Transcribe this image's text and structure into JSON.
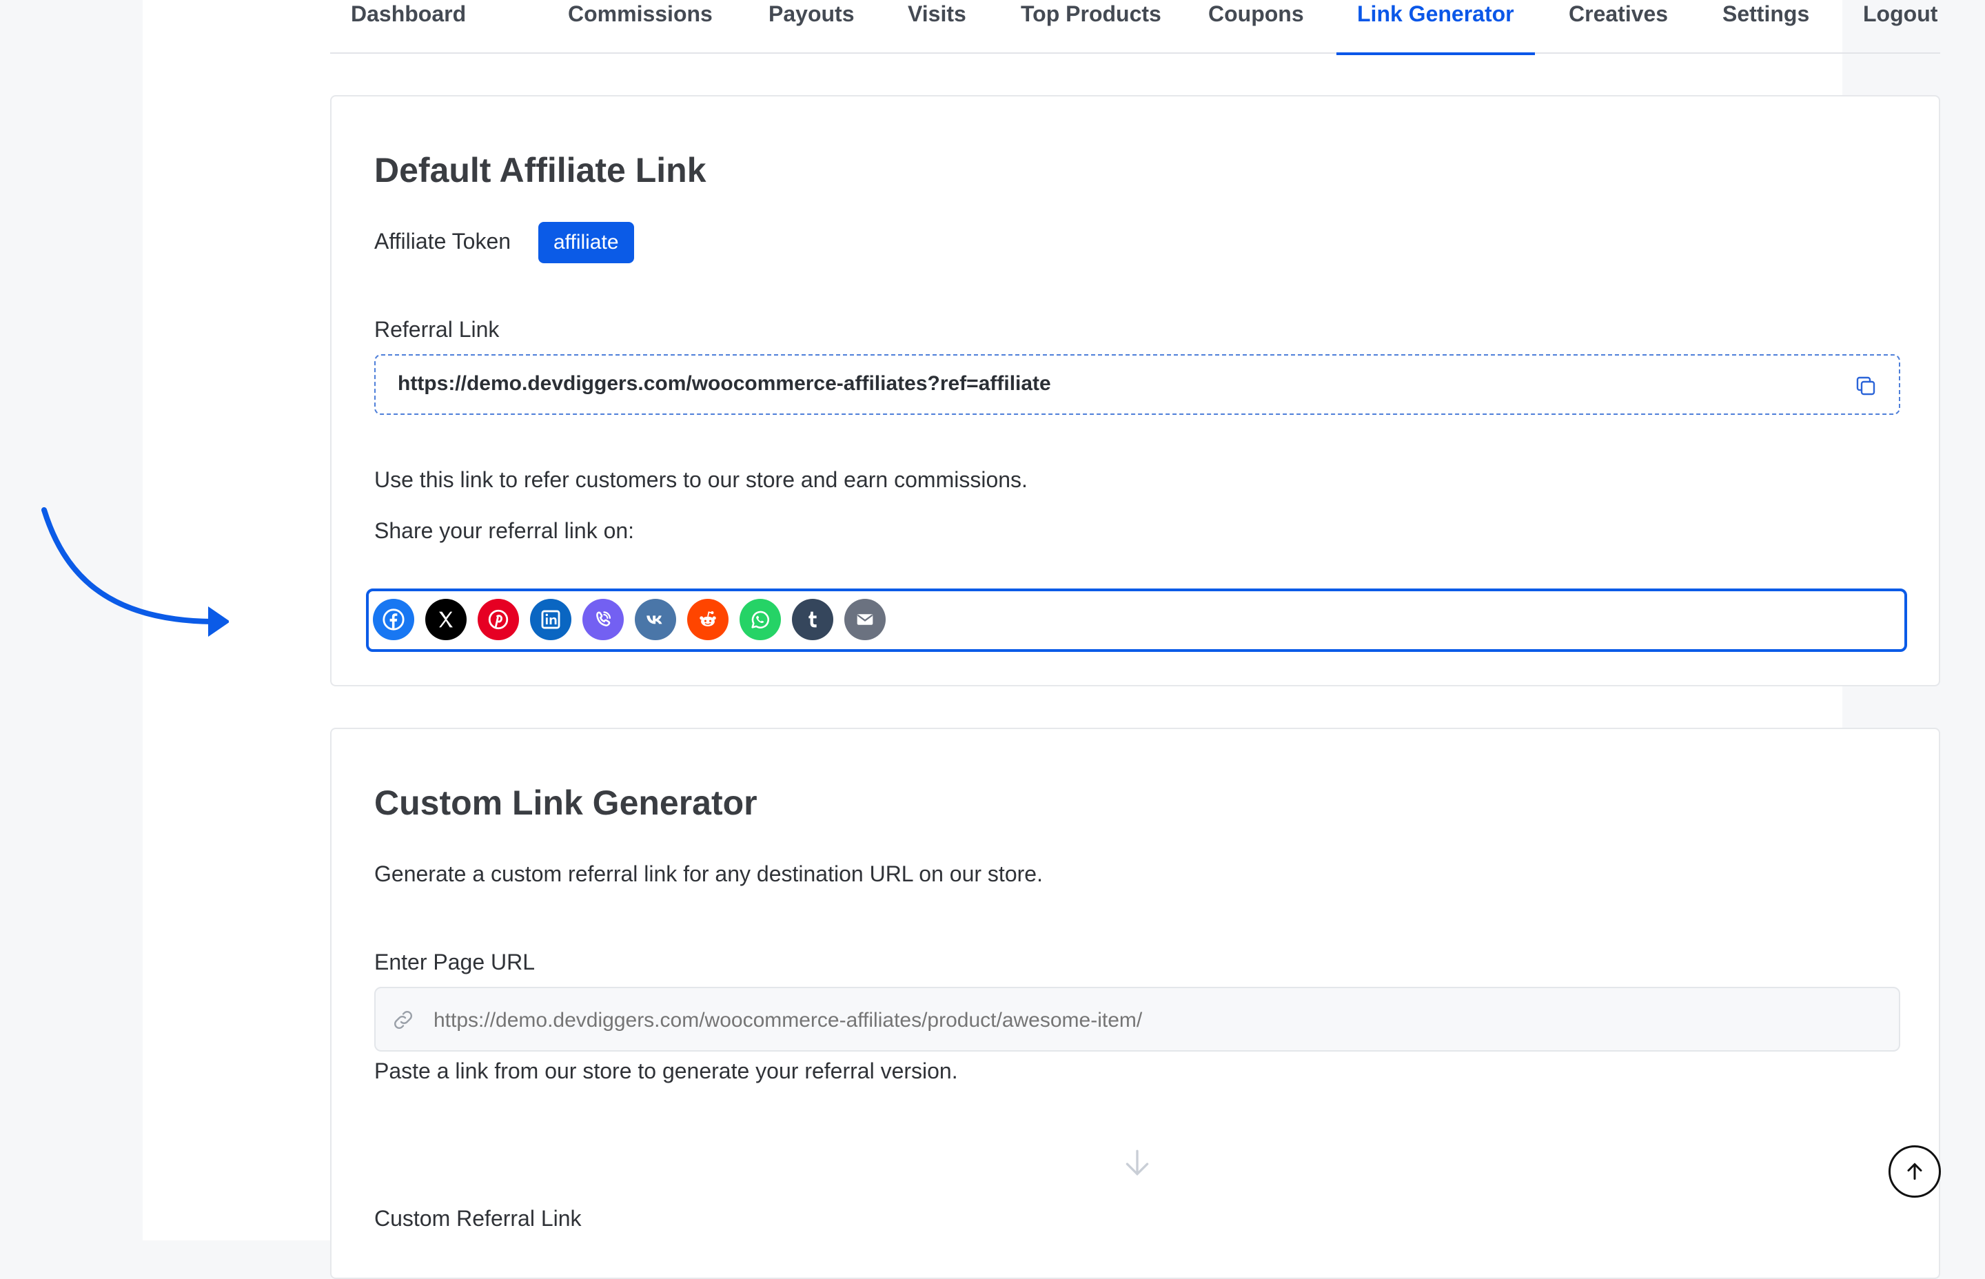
{
  "tabs": [
    {
      "label": "Dashboard",
      "active": false
    },
    {
      "label": "Commissions",
      "active": false
    },
    {
      "label": "Payouts",
      "active": false
    },
    {
      "label": "Visits",
      "active": false
    },
    {
      "label": "Top Products",
      "active": false
    },
    {
      "label": "Coupons",
      "active": false
    },
    {
      "label": "Link Generator",
      "active": true
    },
    {
      "label": "Creatives",
      "active": false
    },
    {
      "label": "Settings",
      "active": false
    },
    {
      "label": "Logout",
      "active": false
    }
  ],
  "default_link": {
    "title": "Default Affiliate Link",
    "token_label": "Affiliate Token",
    "token_value": "affiliate",
    "referral_label": "Referral Link",
    "referral_url": "https://demo.devdiggers.com/woocommerce-affiliates?ref=affiliate",
    "description": "Use this link to refer customers to our store and earn commissions.",
    "share_label": "Share your referral link on:",
    "share_icons": [
      "facebook-icon",
      "x-twitter-icon",
      "pinterest-icon",
      "linkedin-icon",
      "viber-icon",
      "vk-icon",
      "reddit-icon",
      "whatsapp-icon",
      "tumblr-icon",
      "email-icon"
    ]
  },
  "custom_link": {
    "title": "Custom Link Generator",
    "description": "Generate a custom referral link for any destination URL on our store.",
    "url_label": "Enter Page URL",
    "url_placeholder": "https://demo.devdiggers.com/woocommerce-affiliates/product/awesome-item/",
    "url_help": "Paste a link from our store to generate your referral version.",
    "result_label": "Custom Referral Link"
  },
  "colors": {
    "accent": "#0b5be7",
    "facebook": "#1877f2",
    "x": "#000000",
    "pinterest": "#e60023",
    "linkedin": "#0a66c2",
    "viber": "#7360f2",
    "vk": "#4a76a8",
    "reddit": "#ff4500",
    "whatsapp": "#25d366",
    "tumblr": "#35465c",
    "email": "#6b7280"
  }
}
